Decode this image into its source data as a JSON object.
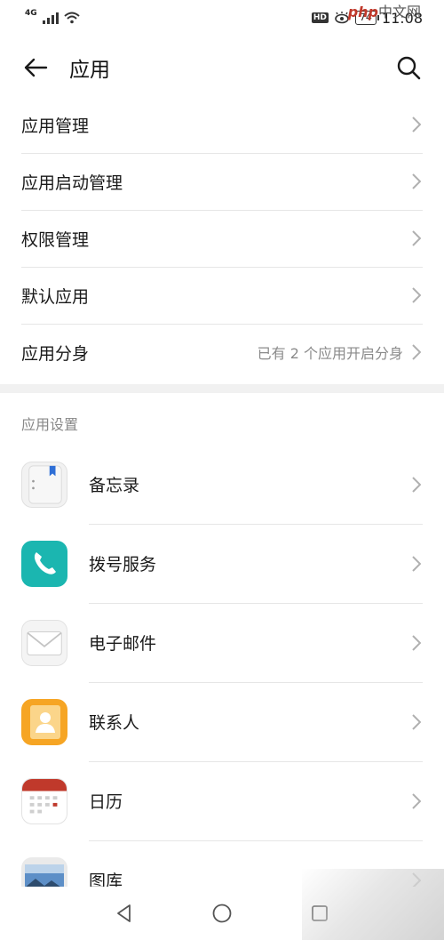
{
  "status_bar": {
    "network": "4G",
    "hd": "HD",
    "battery": "74",
    "time": "11:08"
  },
  "watermark": {
    "brand": "php",
    "suffix": "中文网"
  },
  "header": {
    "title": "应用"
  },
  "top_items": [
    {
      "label": "应用管理",
      "value": ""
    },
    {
      "label": "应用启动管理",
      "value": ""
    },
    {
      "label": "权限管理",
      "value": ""
    },
    {
      "label": "默认应用",
      "value": ""
    },
    {
      "label": "应用分身",
      "value": "已有 2 个应用开启分身"
    }
  ],
  "section": {
    "title": "应用设置"
  },
  "apps": [
    {
      "label": "备忘录",
      "icon": "notepad-icon"
    },
    {
      "label": "拨号服务",
      "icon": "phone-icon"
    },
    {
      "label": "电子邮件",
      "icon": "mail-icon"
    },
    {
      "label": "联系人",
      "icon": "contacts-icon"
    },
    {
      "label": "日历",
      "icon": "calendar-icon"
    },
    {
      "label": "图库",
      "icon": "gallery-icon"
    }
  ],
  "colors": {
    "phone_teal": "#1bb6b0",
    "contacts_orange": "#f6a524",
    "calendar_red": "#c0392b",
    "notepad_blue": "#2f6fd6"
  }
}
